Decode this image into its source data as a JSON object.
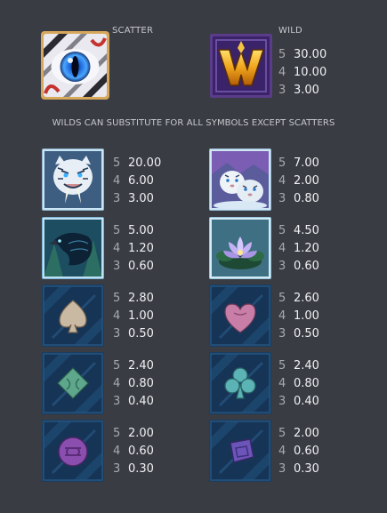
{
  "scatter": {
    "label": "SCATTER",
    "icon": "blue-eye-icon"
  },
  "wild": {
    "label": "WILD",
    "icon": "gold-w-icon",
    "pays": [
      {
        "count": "5",
        "value": "30.00"
      },
      {
        "count": "4",
        "value": "10.00"
      },
      {
        "count": "3",
        "value": "3.00"
      }
    ]
  },
  "note": "WILDS CAN SUBSTITUTE FOR ALL SYMBOLS EXCEPT SCATTERS",
  "symbols": [
    {
      "icon": "white-tiger-icon",
      "pays": [
        {
          "count": "5",
          "value": "20.00"
        },
        {
          "count": "4",
          "value": "6.00"
        },
        {
          "count": "3",
          "value": "3.00"
        }
      ]
    },
    {
      "icon": "tiger-cubs-icon",
      "pays": [
        {
          "count": "5",
          "value": "7.00"
        },
        {
          "count": "4",
          "value": "2.00"
        },
        {
          "count": "3",
          "value": "0.80"
        }
      ]
    },
    {
      "icon": "raven-icon",
      "pays": [
        {
          "count": "5",
          "value": "5.00"
        },
        {
          "count": "4",
          "value": "1.20"
        },
        {
          "count": "3",
          "value": "0.60"
        }
      ]
    },
    {
      "icon": "lotus-flower-icon",
      "pays": [
        {
          "count": "5",
          "value": "4.50"
        },
        {
          "count": "4",
          "value": "1.20"
        },
        {
          "count": "3",
          "value": "0.60"
        }
      ]
    },
    {
      "icon": "spade-icon",
      "pays": [
        {
          "count": "5",
          "value": "2.80"
        },
        {
          "count": "4",
          "value": "1.00"
        },
        {
          "count": "3",
          "value": "0.50"
        }
      ]
    },
    {
      "icon": "heart-icon",
      "pays": [
        {
          "count": "5",
          "value": "2.60"
        },
        {
          "count": "4",
          "value": "1.00"
        },
        {
          "count": "3",
          "value": "0.50"
        }
      ]
    },
    {
      "icon": "diamond-icon",
      "pays": [
        {
          "count": "5",
          "value": "2.40"
        },
        {
          "count": "4",
          "value": "0.80"
        },
        {
          "count": "3",
          "value": "0.40"
        }
      ]
    },
    {
      "icon": "club-icon",
      "pays": [
        {
          "count": "5",
          "value": "2.40"
        },
        {
          "count": "4",
          "value": "0.80"
        },
        {
          "count": "3",
          "value": "0.40"
        }
      ]
    },
    {
      "icon": "purple-coin-icon",
      "pays": [
        {
          "count": "5",
          "value": "2.00"
        },
        {
          "count": "4",
          "value": "0.60"
        },
        {
          "count": "3",
          "value": "0.30"
        }
      ]
    },
    {
      "icon": "purple-gem-icon",
      "pays": [
        {
          "count": "5",
          "value": "2.00"
        },
        {
          "count": "4",
          "value": "0.60"
        },
        {
          "count": "3",
          "value": "0.30"
        }
      ]
    }
  ],
  "colors": {
    "background": "#393c43",
    "text": "#e8e8ea",
    "muted": "#a9aaad",
    "card_low": "#163456",
    "wild_gold": "#e6a21c",
    "scatter_eye": "#2c7fe0"
  }
}
